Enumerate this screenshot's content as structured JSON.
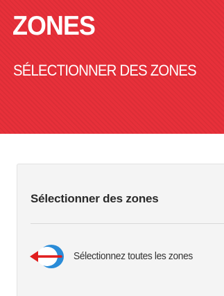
{
  "header": {
    "title": "ZONES",
    "subtitle": "SÉLECTIONNER DES ZONES",
    "background_color": "#e8303a"
  },
  "card": {
    "title": "Sélectionner des zones",
    "select_all": {
      "label": "Sélectionnez toutes les zones",
      "icon": "select-all-toggle-icon",
      "arrow_icon": "left-arrow-icon",
      "toggle_color": "#2a8cd8",
      "arrow_color": "#e01e1e"
    }
  }
}
